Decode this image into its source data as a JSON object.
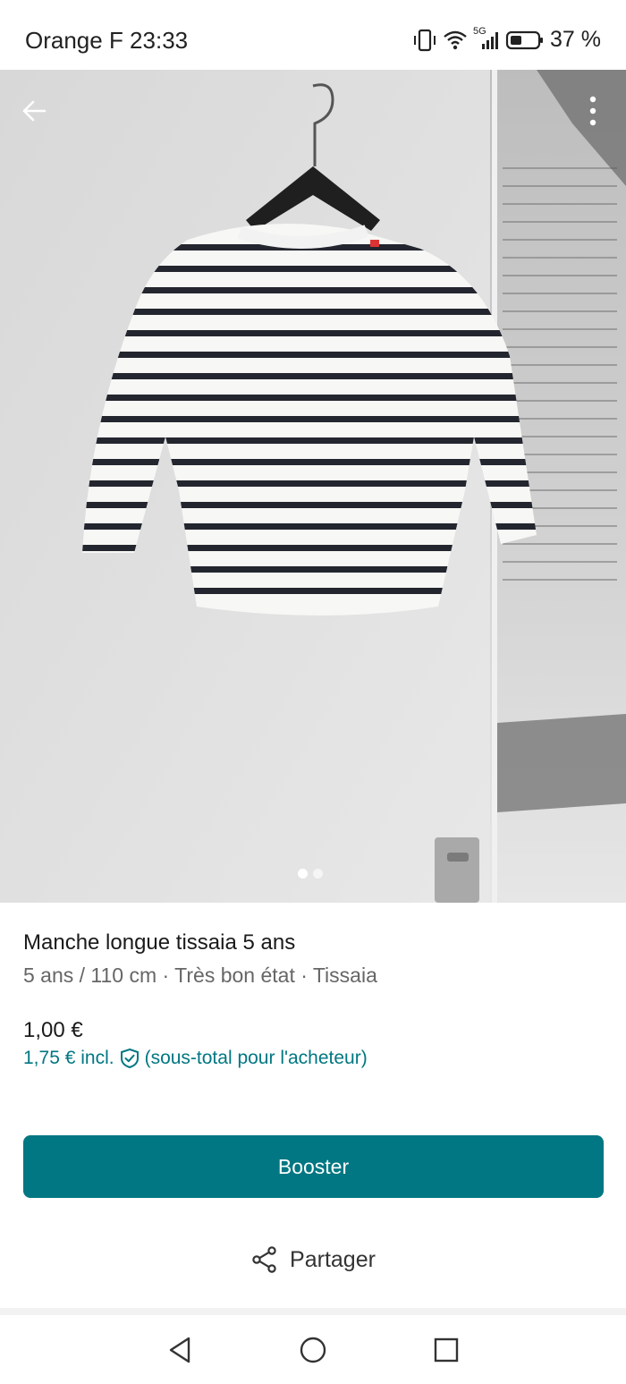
{
  "status_bar": {
    "carrier_time": "Orange F 23:33",
    "network": "5G",
    "battery": "37 %",
    "icons": [
      "vibrate-icon",
      "wifi-icon",
      "signal-icon",
      "battery-icon"
    ]
  },
  "photo": {
    "page_count": 2,
    "active_index": 0,
    "icons": [
      "back-arrow-icon",
      "more-vertical-icon"
    ]
  },
  "item": {
    "title": "Manche longue tissaia 5 ans",
    "subtitle": "5 ans / 110 cm · Très bon état · Tissaia",
    "price": "1,00 €",
    "price_incl": "1,75 € incl.",
    "price_note": "(sous-total pour l'acheteur)"
  },
  "actions": {
    "booster_label": "Booster",
    "share_label": "Partager"
  },
  "colors": {
    "accent": "#007782"
  },
  "nav": {
    "icons": [
      "nav-back-icon",
      "nav-home-icon",
      "nav-recents-icon"
    ]
  }
}
